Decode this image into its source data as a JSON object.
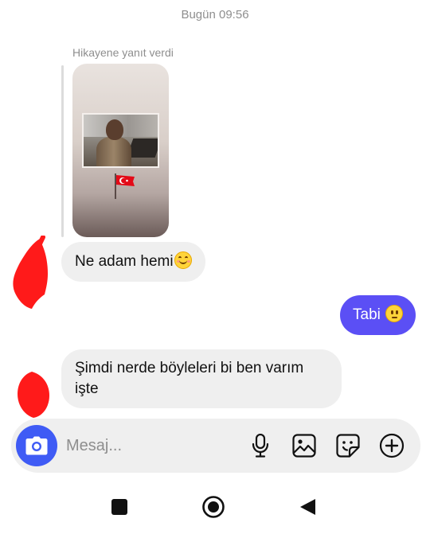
{
  "header": {
    "timestamp": "Bugün 09:56"
  },
  "story_reply": {
    "label": "Hikayene yanıt verdi"
  },
  "messages": [
    {
      "direction": "incoming",
      "text": "Ne adam hemi",
      "emoji": "smiling-face-blush"
    },
    {
      "direction": "outgoing",
      "text": "Tabi",
      "emoji": "neutral-face"
    },
    {
      "direction": "incoming",
      "line1": "Şimdi nerde böyleleri bi ben varım",
      "line2": "işte"
    }
  ],
  "composer": {
    "placeholder": "Mesaj...",
    "value": "",
    "icons": [
      "camera-icon",
      "microphone-icon",
      "gallery-icon",
      "sticker-icon",
      "plus-icon"
    ]
  },
  "navigation": {
    "icons": [
      "recents-icon",
      "home-icon",
      "back-icon"
    ]
  },
  "colors": {
    "outgoing_bubble": "#5b4ff5",
    "incoming_bubble": "#efefef",
    "camera_button": "#3f5bf5",
    "redaction": "#ff1a1a"
  }
}
